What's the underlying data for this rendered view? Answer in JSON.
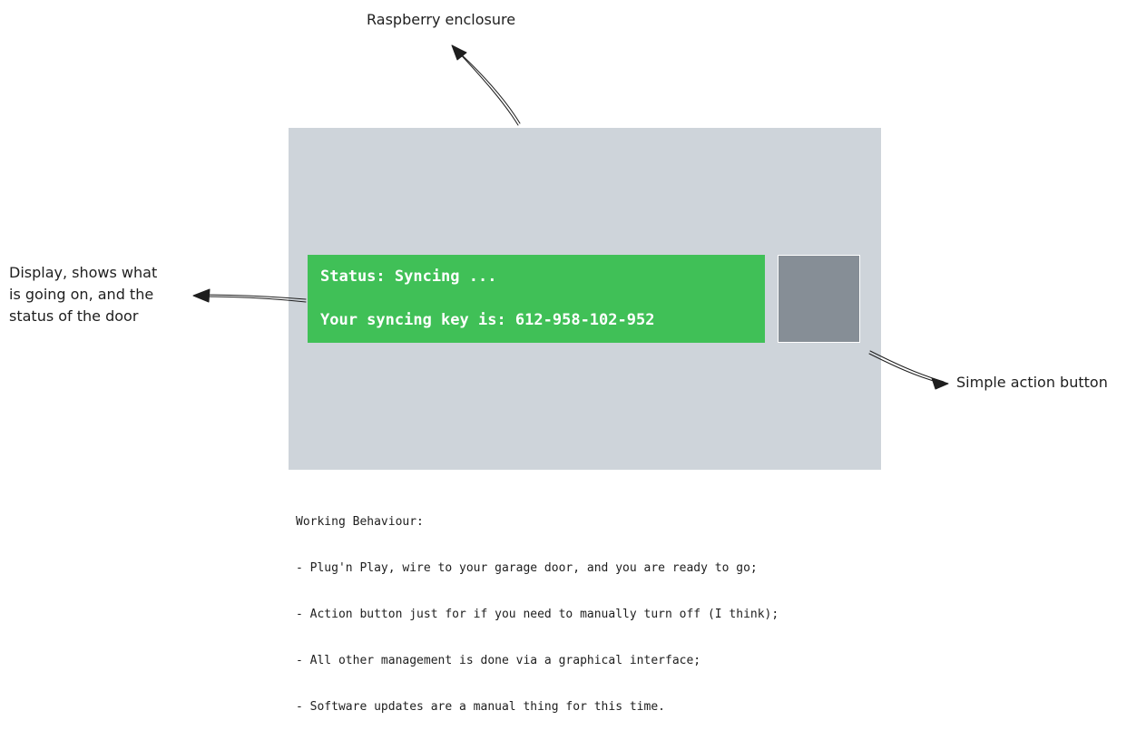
{
  "annotations": {
    "enclosure_label": "Raspberry enclosure",
    "display_label": {
      "line1": "Display, shows what",
      "line2": "is going on, and the",
      "line3": "status of the door"
    },
    "button_label": "Simple action button"
  },
  "display": {
    "status_line": "Status: Syncing ...",
    "key_line": "Your syncing key is: 612-958-102-952"
  },
  "notes": {
    "heading": "Working Behaviour:",
    "items": [
      "- Plug'n Play, wire to your garage door, and you are ready to go;",
      "- Action button just for if you need to manually turn off (I think);",
      "- All other management is done via a graphical interface;",
      "- Software updates are a manual thing for this time."
    ]
  },
  "colors": {
    "enclosure": "#ced4da",
    "display": "#40c057",
    "button": "#868e96",
    "stroke": "#1e1e1e"
  }
}
